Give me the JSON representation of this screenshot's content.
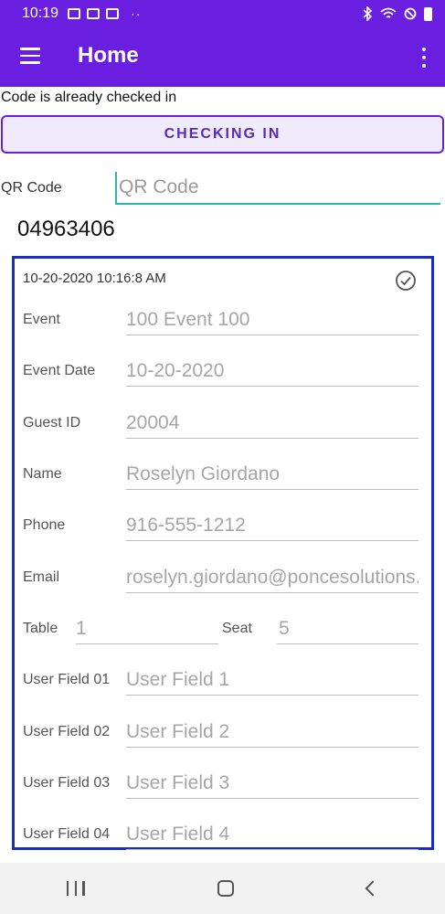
{
  "status_bar": {
    "time": "10:19",
    "more": "··"
  },
  "app_bar": {
    "title": "Home"
  },
  "message": "Code is already checked in",
  "checkin_button": {
    "label": "CHECKING IN"
  },
  "qr": {
    "label": "QR Code",
    "placeholder": "QR Code"
  },
  "code_value": "04963406",
  "card": {
    "timestamp": "10-20-2020 10:16:8 AM",
    "fields": [
      {
        "label": "Event",
        "value": "100 Event 100"
      },
      {
        "label": "Event Date",
        "value": "10-20-2020"
      },
      {
        "label": "Guest ID",
        "value": "20004"
      },
      {
        "label": "Name",
        "value": "Roselyn Giordano"
      },
      {
        "label": "Phone",
        "value": "916-555-1212"
      },
      {
        "label": "Email",
        "value": "roselyn.giordano@poncesolutions.com"
      }
    ],
    "table": {
      "label": "Table",
      "value": "1"
    },
    "seat": {
      "label": "Seat",
      "value": "5"
    },
    "user_fields": [
      {
        "label": "User Field 01",
        "value": "User Field 1"
      },
      {
        "label": "User Field 02",
        "value": "User Field 2"
      },
      {
        "label": "User Field 03",
        "value": "User Field 3"
      },
      {
        "label": "User Field 04",
        "value": "User Field 4"
      }
    ]
  },
  "colors": {
    "primary": "#6a1ee0",
    "card_border": "#1a2dc4",
    "accent": "#2cb8a8"
  }
}
